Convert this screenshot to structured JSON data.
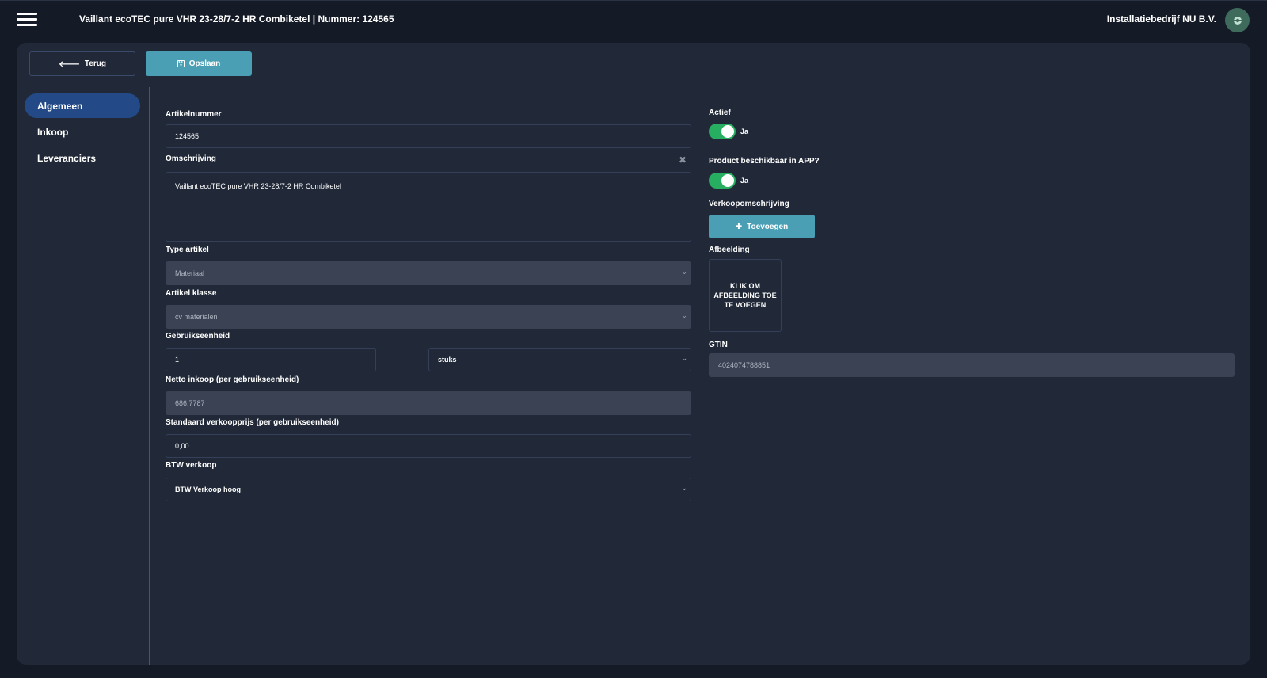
{
  "header": {
    "title": "Vaillant ecoTEC pure VHR 23-28/7-2 HR Combiketel | Nummer: 124565",
    "company": "Installatiebedrijf NU B.V.",
    "menu_icon": "hamburger-menu-icon",
    "avatar_icon": "user-avatar-icon"
  },
  "toolbar": {
    "back_label": "Terug",
    "save_label": "Opslaan"
  },
  "sidebar": {
    "items": [
      {
        "label": "Algemeen",
        "active": true
      },
      {
        "label": "Inkoop",
        "active": false
      },
      {
        "label": "Leveranciers",
        "active": false
      }
    ]
  },
  "form": {
    "artikelnummer": {
      "label": "Artikelnummer",
      "value": "124565"
    },
    "omschrijving": {
      "label": "Omschrijving",
      "value": "Vaillant ecoTEC pure VHR 23-28/7-2 HR Combiketel"
    },
    "type_artikel": {
      "label": "Type artikel",
      "value": "Materiaal"
    },
    "artikel_klasse": {
      "label": "Artikel klasse",
      "value": "cv materialen"
    },
    "gebruikseenheid": {
      "label": "Gebruikseenheid",
      "amount": "1",
      "unit": "stuks"
    },
    "netto_inkoop": {
      "label": "Netto inkoop (per gebruikseenheid)",
      "value": "686,7787"
    },
    "verkoopprijs": {
      "label": "Standaard verkoopprijs (per gebruikseenheid)",
      "value": "0,00"
    },
    "btw_verkoop": {
      "label": "BTW verkoop",
      "value": "BTW Verkoop hoog"
    },
    "actief": {
      "label": "Actief",
      "state": "Ja"
    },
    "app": {
      "label": "Product beschikbaar in APP?",
      "state": "Ja"
    },
    "verkoopomschrijving": {
      "label": "Verkoopomschrijving",
      "add_label": "Toevoegen"
    },
    "afbeelding": {
      "label": "Afbeelding",
      "placeholder": "KLIK OM AFBEELDING TOE TE VOEGEN"
    },
    "gtin": {
      "label": "GTIN",
      "value": "4024074788851"
    }
  },
  "colors": {
    "accent": "#4a9fb5",
    "active_nav": "#234a86",
    "toggle_on": "#27ae60",
    "panel": "#212938",
    "background": "#141a26"
  }
}
